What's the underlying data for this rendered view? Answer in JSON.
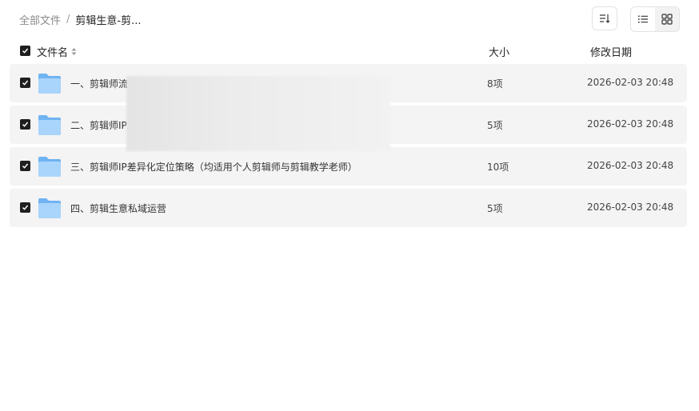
{
  "breadcrumb": {
    "root": "全部文件",
    "separator": "/",
    "current": "剪辑生意-剪..."
  },
  "toolbar": {
    "sort_icon": "sort-icon",
    "list_view_icon": "list-view-icon",
    "grid_view_icon": "grid-view-icon",
    "active_view": "list"
  },
  "header": {
    "name": "文件名",
    "size": "大小",
    "date": "修改日期"
  },
  "files": [
    {
      "name": "一、剪辑师流",
      "size": "8项",
      "date": "2026-02-03 20:48",
      "checked": true
    },
    {
      "name": "二、剪辑师IP",
      "size": "5项",
      "date": "2026-02-03 20:48",
      "checked": true
    },
    {
      "name": "三、剪辑师IP差异化定位策略（均适用个人剪辑师与剪辑教学老师）",
      "size": "10项",
      "date": "2026-02-03 20:48",
      "checked": true
    },
    {
      "name": "四、剪辑生意私域运营",
      "size": "5项",
      "date": "2026-02-03 20:48",
      "checked": true
    }
  ],
  "colors": {
    "folder_light": "#a9d4fb",
    "folder_dark": "#6fb3f2",
    "row_bg": "#f4f4f4",
    "checkbox": "#1f1f1f"
  }
}
